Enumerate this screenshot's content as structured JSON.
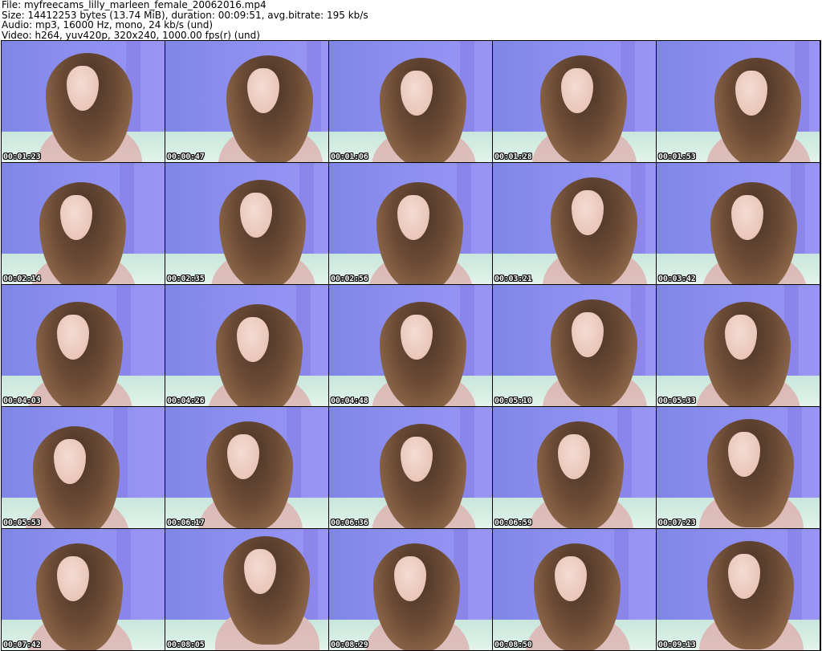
{
  "header": {
    "file_line": "File: myfreecams_lilly_marleen_female_20062016.mp4",
    "size_line": "Size: 14412253 bytes (13.74 MiB), duration: 00:09:51, avg.bitrate: 195 kb/s",
    "audio_line": "Audio: mp3, 16000 Hz, mono, 24 kb/s (und)",
    "video_line": "Video: h264, yuv420p, 320x240, 1000.00 fps(r) (und)"
  },
  "thumbnails": [
    {
      "timestamp": "00:01:23"
    },
    {
      "timestamp": "00:00:47"
    },
    {
      "timestamp": "00:01:06"
    },
    {
      "timestamp": "00:01:28"
    },
    {
      "timestamp": "00:01:53"
    },
    {
      "timestamp": "00:02:14"
    },
    {
      "timestamp": "00:02:35"
    },
    {
      "timestamp": "00:02:56"
    },
    {
      "timestamp": "00:03:21"
    },
    {
      "timestamp": "00:03:42"
    },
    {
      "timestamp": "00:04:03"
    },
    {
      "timestamp": "00:04:26"
    },
    {
      "timestamp": "00:04:48"
    },
    {
      "timestamp": "00:05:10"
    },
    {
      "timestamp": "00:05:33"
    },
    {
      "timestamp": "00:05:53"
    },
    {
      "timestamp": "00:06:17"
    },
    {
      "timestamp": "00:06:36"
    },
    {
      "timestamp": "00:06:59"
    },
    {
      "timestamp": "00:07:23"
    },
    {
      "timestamp": "00:07:42"
    },
    {
      "timestamp": "00:08:05"
    },
    {
      "timestamp": "00:08:29"
    },
    {
      "timestamp": "00:08:50"
    },
    {
      "timestamp": "00:09:13"
    }
  ],
  "colors": {
    "background": "#ffffff",
    "grid_border": "#000000",
    "wall": "#8c8ff0",
    "couch": "#d6eee4",
    "hair": "#6a4a35",
    "sweater": "#e2c4c0",
    "timestamp_text": "#ffffff"
  }
}
